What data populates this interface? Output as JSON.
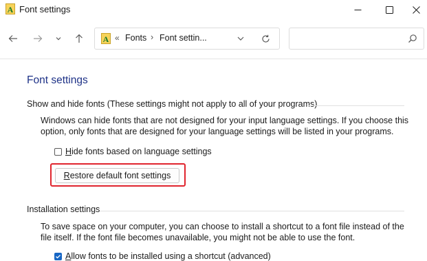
{
  "window": {
    "title": "Font settings",
    "buttons": {
      "minimize": "minimize-icon",
      "maximize": "maximize-icon",
      "close": "close-icon"
    }
  },
  "nav": {
    "address": {
      "separator1": "«",
      "crumb1": "Fonts",
      "separator2": "›",
      "crumb2": "Font settin..."
    },
    "search": {
      "placeholder": ""
    }
  },
  "page": {
    "title": "Font settings",
    "show_hide": {
      "header": "Show and hide fonts (These settings might not apply to all of your programs)",
      "description": "Windows can hide fonts that are not designed for your input language settings. If you choose this option, only fonts that are designed for your language settings will be listed in your programs.",
      "checkbox_label_accel": "H",
      "checkbox_label_rest": "ide fonts based on language settings",
      "checkbox_checked": false,
      "restore_button_accel": "R",
      "restore_button_rest": "estore default font settings"
    },
    "installation": {
      "header": "Installation settings",
      "description": "To save space on your computer, you can choose to install a shortcut to a font file instead of the file itself. If the font file becomes unavailable, you might not be able to use the font.",
      "checkbox_label_accel": "A",
      "checkbox_label_rest": "llow fonts to be installed using a shortcut (advanced)",
      "checkbox_checked": true
    }
  },
  "colors": {
    "title_blue": "#1e3287",
    "highlight_red": "#e0242d",
    "checkbox_blue": "#1766c4"
  }
}
